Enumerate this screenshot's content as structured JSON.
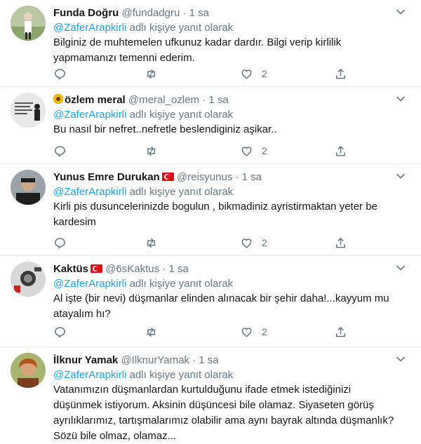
{
  "common": {
    "reply_prefix": "@ZaferArapkirli",
    "reply_suffix": " adlı kişiye yanıt olarak",
    "separator": " · "
  },
  "tweets": [
    {
      "name": "Funda Doğru",
      "handle": "@fundadgru",
      "time": "1 sa",
      "lines": [
        "Bilginiz de muhtemelen ufkunuz kadar dardır. Bilgi verip kirlilik",
        "yapmamanızı temenni ederim."
      ],
      "likes": "2"
    },
    {
      "name": "özlem meral",
      "handle": "@meral_ozlem",
      "time": "1 sa",
      "lines": [
        "Bu nasıl bir nefret..nefretle beslendiginiz aşikar.."
      ],
      "likes": "2"
    },
    {
      "name": "Yunus Emre Durukan",
      "handle": "@reisyunus",
      "time": "1 sa",
      "lines": [
        "Kirli pis dusuncelerinizde bogulun , bikmadiniz ayristirmaktan yeter be",
        "kardesim"
      ],
      "likes": "2"
    },
    {
      "name": "Kaktüs",
      "handle": "@6sKaktus",
      "time": "1 sa",
      "lines": [
        "Al işte (bir nevi) düşmanlar elinden alınacak bir şehir daha!...kayyum mu",
        "atayalım hı?"
      ],
      "likes": "2"
    },
    {
      "name": "İlknur Yamak",
      "handle": "@IlknurYamak",
      "time": "1 sa",
      "lines": [
        "Vatanımızın düşmanlardan kurtulduğunu ifade etmek istediğinizi",
        "düşünmek istiyorum. Aksinin düşüncesi bile olamaz. Siyaseten görüş",
        "ayrılıklarımız, tartışmalarımız olabilir ama aynı bayrak altında düşmanlık?",
        "Sözü bile olmaz, olamaz..."
      ],
      "likes": ""
    }
  ],
  "colors": {
    "link": "#1da1f2",
    "meta": "#657786",
    "text": "#14171a",
    "border": "#e6ecf0"
  },
  "icons": [
    "reply-icon",
    "retweet-icon",
    "like-icon",
    "share-icon",
    "chevron-down-icon"
  ]
}
